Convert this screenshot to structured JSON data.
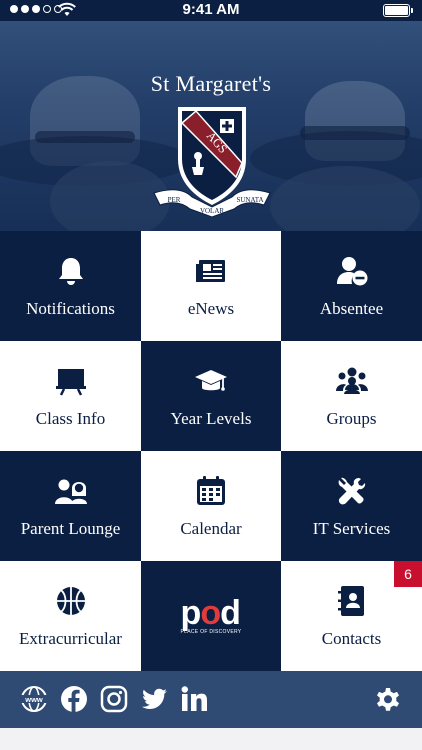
{
  "status_bar": {
    "time": "9:41 AM"
  },
  "hero": {
    "school_name": "St Margaret's",
    "crest_text": "AGS",
    "motto": [
      "PER",
      "VOLAR",
      "SUNATA"
    ]
  },
  "tiles": [
    {
      "label": "Notifications",
      "icon": "bell-icon",
      "theme": "dark"
    },
    {
      "label": "eNews",
      "icon": "newspaper-icon",
      "theme": "light"
    },
    {
      "label": "Absentee",
      "icon": "user-minus-icon",
      "theme": "dark"
    },
    {
      "label": "Class Info",
      "icon": "presentation-board-icon",
      "theme": "light"
    },
    {
      "label": "Year Levels",
      "icon": "graduation-cap-icon",
      "theme": "dark"
    },
    {
      "label": "Groups",
      "icon": "users-group-icon",
      "theme": "light"
    },
    {
      "label": "Parent Lounge",
      "icon": "parents-icon",
      "theme": "dark"
    },
    {
      "label": "Calendar",
      "icon": "calendar-icon",
      "theme": "light"
    },
    {
      "label": "IT Services",
      "icon": "tools-icon",
      "theme": "dark"
    },
    {
      "label": "Extracurricular",
      "icon": "basketball-icon",
      "theme": "light"
    },
    {
      "label": "",
      "icon": "pod-logo",
      "theme": "dark",
      "logo_text": "pod",
      "logo_sub": "PLACE OF DISCOVERY"
    },
    {
      "label": "Contacts",
      "icon": "address-book-icon",
      "theme": "light",
      "badge": "6"
    }
  ],
  "bottom_bar": {
    "icons": [
      "www-globe-icon",
      "facebook-icon",
      "instagram-icon",
      "twitter-icon",
      "linkedin-icon",
      "settings-gear-icon"
    ]
  },
  "colors": {
    "navy": "#0b1f43",
    "bottom_bar": "#2f4b73",
    "badge_red": "#c8102e",
    "white": "#ffffff"
  }
}
